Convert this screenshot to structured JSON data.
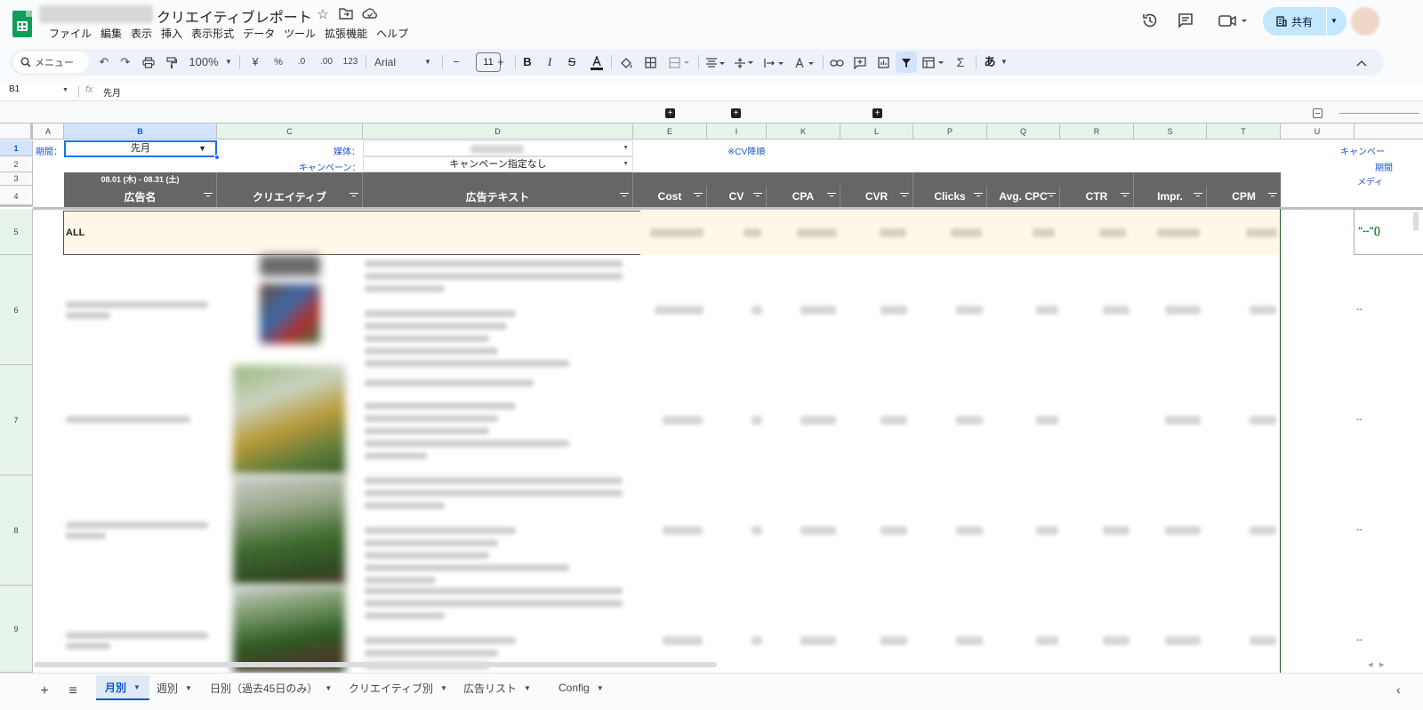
{
  "document": {
    "title": "クリエイティブレポート",
    "menu": [
      "ファイル",
      "編集",
      "表示",
      "挿入",
      "表示形式",
      "データ",
      "ツール",
      "拡張機能",
      "ヘルプ"
    ],
    "share_label": "共有"
  },
  "toolbar": {
    "search_placeholder": "メニュー",
    "zoom": "100%",
    "currency": "¥",
    "percent": "%",
    "decrease_decimal": ".0",
    "increase_decimal": ".00",
    "number_format": "123",
    "font": "Arial",
    "font_size": "11",
    "input_tools": "あ"
  },
  "formula_bar": {
    "cell_ref": "B1",
    "fx": "fx",
    "content": "先月"
  },
  "columns": [
    "A",
    "B",
    "C",
    "D",
    "E",
    "I",
    "K",
    "L",
    "P",
    "Q",
    "R",
    "S",
    "T",
    "U"
  ],
  "rows": [
    "1",
    "2",
    "3",
    "4",
    "5",
    "6",
    "7",
    "8",
    "9"
  ],
  "sheet": {
    "period_label": "期間：",
    "period_value": "先月",
    "media_label": "媒体：",
    "campaign_label": "キャンペーン：",
    "campaign_value": "キャンペーン指定なし",
    "cv_note": "※CV降順",
    "right_label_1": "キャンペー",
    "right_label_2": "期間",
    "right_label_3": "メディ",
    "date_range": "08.01 (木) - 08.31 (土)",
    "headers": [
      "広告名",
      "クリエイティブ",
      "広告テキスト",
      "Cost",
      "CV",
      "CPA",
      "CVR",
      "Clicks",
      "Avg. CPC",
      "CTR",
      "Impr.",
      "CPM"
    ],
    "all_label": "ALL",
    "formula_text": "\"--\"()",
    "dash": "--"
  },
  "tabs": [
    {
      "label": "月別",
      "active": true
    },
    {
      "label": "週別",
      "active": false
    },
    {
      "label": "日別（過去45日のみ）",
      "active": false
    },
    {
      "label": "クリエイティブ別",
      "active": false
    },
    {
      "label": "広告リスト",
      "active": false
    },
    {
      "label": "Config",
      "active": false
    }
  ],
  "colors": {
    "accent": "#0b57d0",
    "header_dark": "#666666",
    "all_row_bg": "#fff8e9",
    "label_blue": "#1a55d4",
    "formula_green": "#188038",
    "share_bg": "#c2e7ff"
  }
}
